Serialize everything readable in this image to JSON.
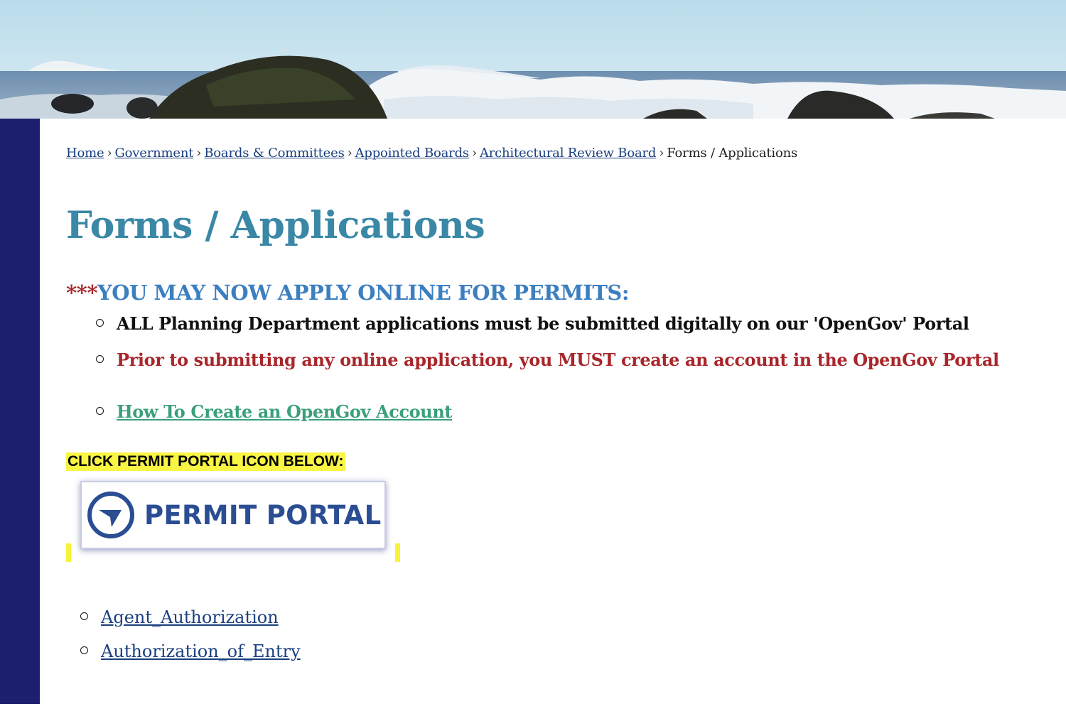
{
  "breadcrumb": {
    "items": [
      "Home",
      "Government",
      "Boards & Committees",
      "Appointed Boards",
      "Architectural Review Board"
    ],
    "current": "Forms / Applications",
    "separator": "›"
  },
  "page": {
    "title": "Forms / Applications"
  },
  "notice": {
    "stars": "***",
    "heading": "YOU MAY NOW APPLY ONLINE FOR PERMITS:",
    "bullets": [
      "ALL Planning Department applications must be submitted digitally on our 'OpenGov' Portal",
      "Prior to submitting any online application, you MUST create an account in the OpenGov Portal"
    ],
    "account_link": "How To Create an OpenGov Account"
  },
  "portal": {
    "label": "CLICK PERMIT PORTAL ICON BELOW:",
    "button_text": "PERMIT PORTAL"
  },
  "documents": [
    "Agent_Authorization",
    "Authorization_of_Entry"
  ],
  "colors": {
    "navy_bar": "#1c1f6e",
    "title": "#3a88a6",
    "warning_red": "#a8262a",
    "notice_blue": "#3c7fc0",
    "link_green": "#3aa07a",
    "link_blue": "#1b3f7f",
    "highlight": "#f9f544",
    "portal_blue": "#2a4d93"
  }
}
